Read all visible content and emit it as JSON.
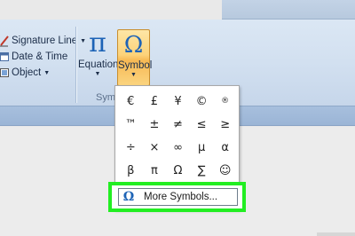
{
  "ribbon": {
    "insert_items": [
      {
        "label": "Signature Line",
        "icon": "signature-line-icon"
      },
      {
        "label": "Date & Time",
        "icon": "date-time-icon"
      },
      {
        "label": "Object",
        "icon": "object-icon"
      }
    ],
    "equation": {
      "glyph": "π",
      "label": "Equation"
    },
    "symbol": {
      "glyph": "Ω",
      "label": "Symbol"
    },
    "group_label": "Symb"
  },
  "symbol_menu": {
    "symbols": [
      "€",
      "£",
      "¥",
      "©",
      "®",
      "™",
      "±",
      "≠",
      "≤",
      "≥",
      "÷",
      "×",
      "∞",
      "µ",
      "α",
      "β",
      "π",
      "Ω",
      "∑",
      "☺"
    ],
    "more_icon": "Ω",
    "more_label": "More Symbols..."
  },
  "colors": {
    "highlight": "#22ee22",
    "symbol_button": "#f7b954",
    "symbol_glyph": "#1d63b6"
  }
}
